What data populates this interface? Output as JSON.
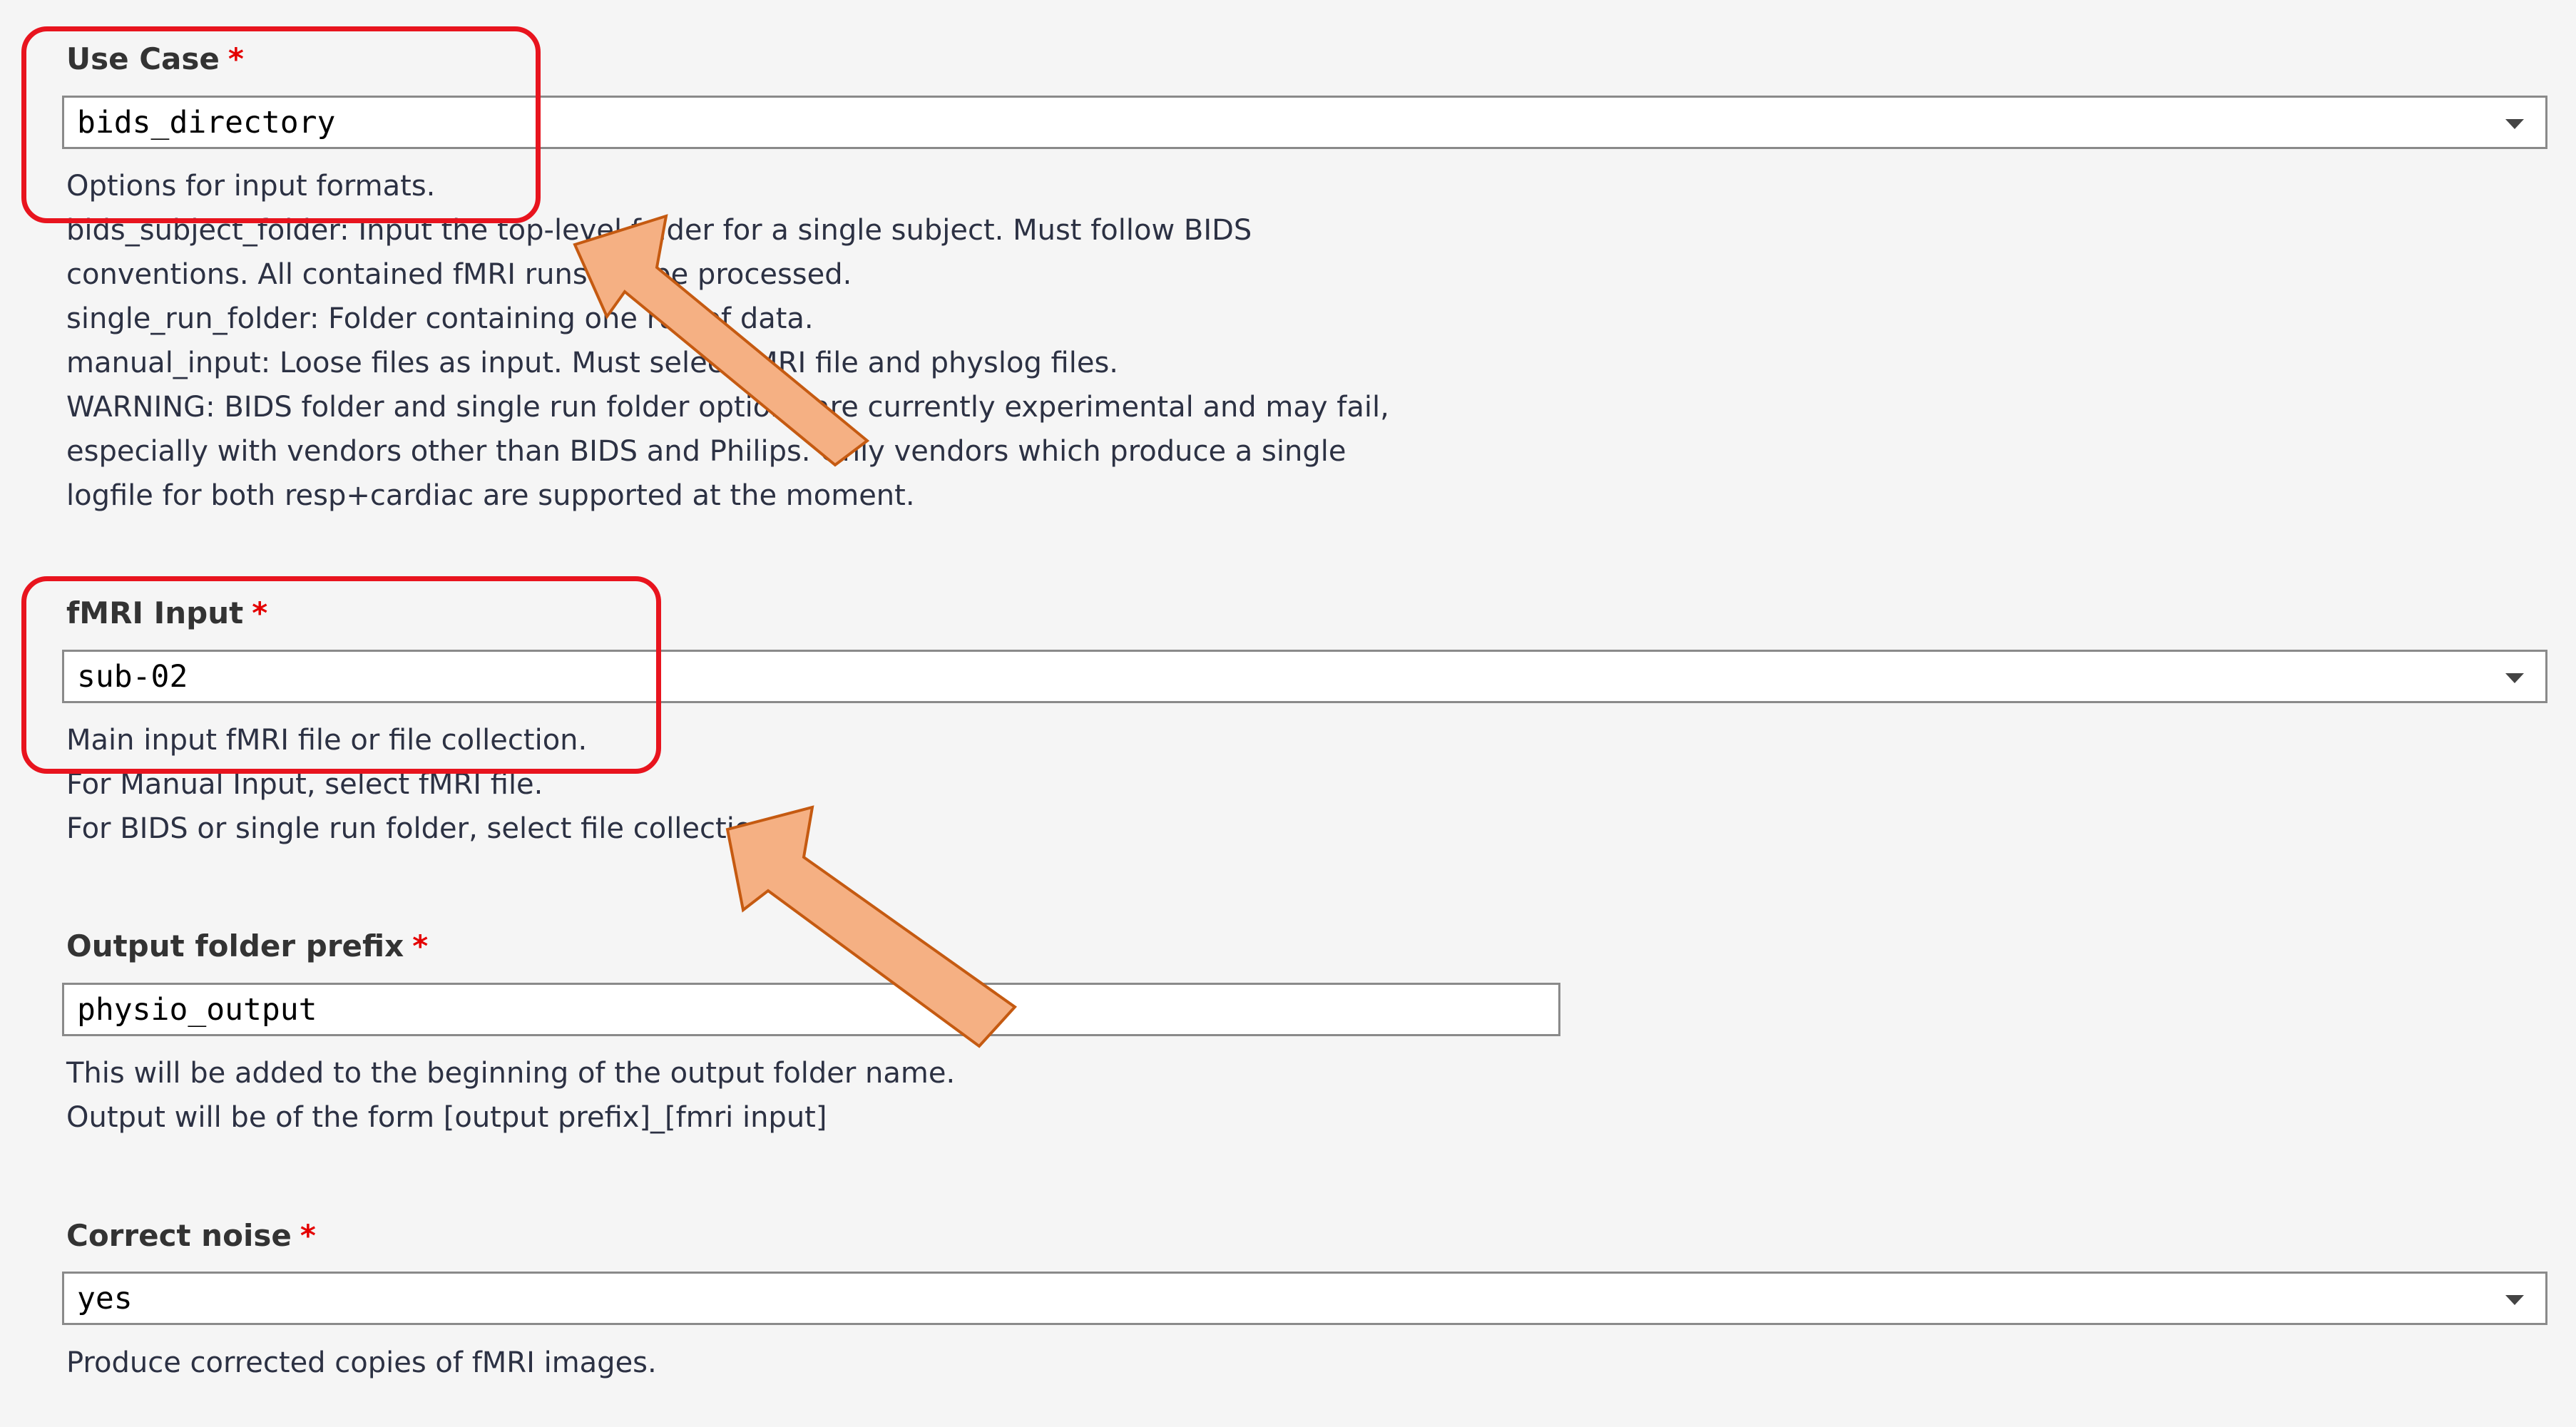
{
  "form": {
    "use_case": {
      "label": "Use Case",
      "required_mark": "*",
      "value": "bids_directory",
      "help_lines": [
        "Options for input formats.",
        "bids_subject_folder: Input the top-level folder for a single subject. Must follow BIDS",
        "conventions. All contained fMRI runs will be processed.",
        "single_run_folder: Folder containing one run of data.",
        "manual_input: Loose files as input. Must select fMRI file and physlog files.",
        "WARNING: BIDS folder and single run folder options are currently experimental and may fail,",
        "especially with vendors other than BIDS and Philips. Only vendors which produce a single",
        "logfile for both resp+cardiac are supported at the moment."
      ]
    },
    "fmri_input": {
      "label": "fMRI Input",
      "required_mark": "*",
      "value": "sub-02",
      "help_lines": [
        "Main input fMRI file or file collection.",
        "For Manual Input, select fMRI file.",
        "For BIDS or single run folder, select file collection."
      ]
    },
    "output_prefix": {
      "label": "Output folder prefix",
      "required_mark": "*",
      "value": "physio_output",
      "help_lines": [
        "This will be added to the beginning of the output folder name.",
        "Output will be of the form [output prefix]_[fmri input]"
      ]
    },
    "correct_noise": {
      "label": "Correct noise",
      "required_mark": "*",
      "value": "yes",
      "help_lines": [
        "Produce corrected copies of fMRI images."
      ]
    }
  },
  "annotations": {
    "box_color": "#e8141e",
    "arrow_fill": "#f5b083",
    "arrow_stroke": "#c55a11"
  }
}
